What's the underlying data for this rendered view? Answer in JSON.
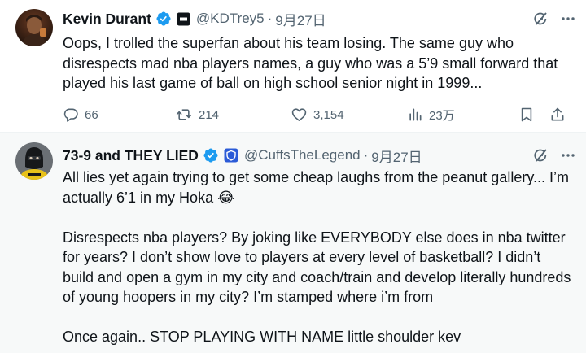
{
  "tweets": [
    {
      "author": {
        "name": "Kevin Durant",
        "handle": "@KDTrey5",
        "date": "9月27日"
      },
      "paragraphs": [
        "Oops, I trolled the superfan about his team losing. The same guy who disrespects mad nba players names, a guy who was a 5’9 small forward that played his last game of ball on high school senior night in 1999..."
      ],
      "stats": {
        "replies": "66",
        "retweets": "214",
        "likes": "3,154",
        "views": "23万"
      }
    },
    {
      "author": {
        "name": "73-9 and THEY LIED",
        "handle": "@CuffsTheLegend",
        "date": "9月27日"
      },
      "paragraphs": [
        "All lies yet again trying to get some cheap laughs from the peanut gallery... I’m actually 6’1 in my Hoka 😂",
        "Disrespects nba players? By joking like EVERYBODY else does in nba twitter for years? I don’t show love to players at every level of basketball? I didn’t build and open a gym in my city and coach/train and develop literally hundreds of young hoopers in my city? I’m stamped where i’m from",
        "Once again.. STOP PLAYING WITH NAME little shoulder kev"
      ]
    }
  ],
  "separator": "·",
  "colors": {
    "verified": "#1d9bf0",
    "secondary_text": "#536471",
    "primary_text": "#0f1419",
    "reply_background": "#f7f9f9"
  },
  "icons": {
    "verified": "verified-badge-icon",
    "affiliate": "affiliate-badge-icon",
    "grok": "grok-icon",
    "more": "more-icon",
    "reply": "reply-icon",
    "retweet": "retweet-icon",
    "like": "like-icon",
    "views": "views-icon",
    "bookmark": "bookmark-icon",
    "share": "share-icon"
  }
}
